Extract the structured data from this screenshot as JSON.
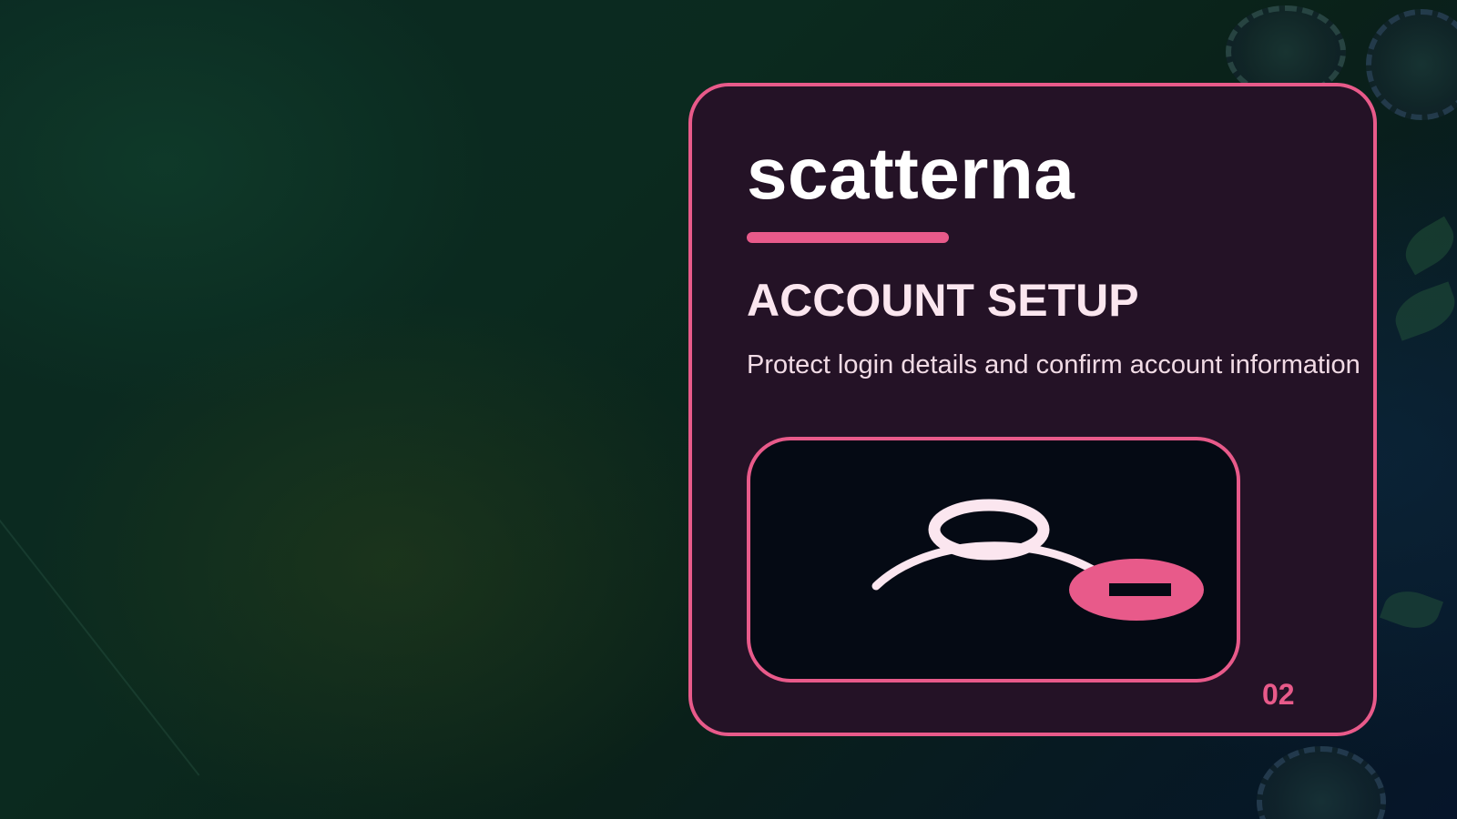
{
  "brand": {
    "name": "scatterna"
  },
  "slide": {
    "heading": "ACCOUNT SETUP",
    "description": "Protect login details and confirm account information",
    "step_number": "02"
  },
  "illustration": {
    "icon": "user-with-lock-icon"
  },
  "colors": {
    "accent": "#e85a8a",
    "card_background": "#241226",
    "illustration_background": "#050a14",
    "heading_text": "#fbe6ef",
    "page_background": "#0b2a22"
  }
}
